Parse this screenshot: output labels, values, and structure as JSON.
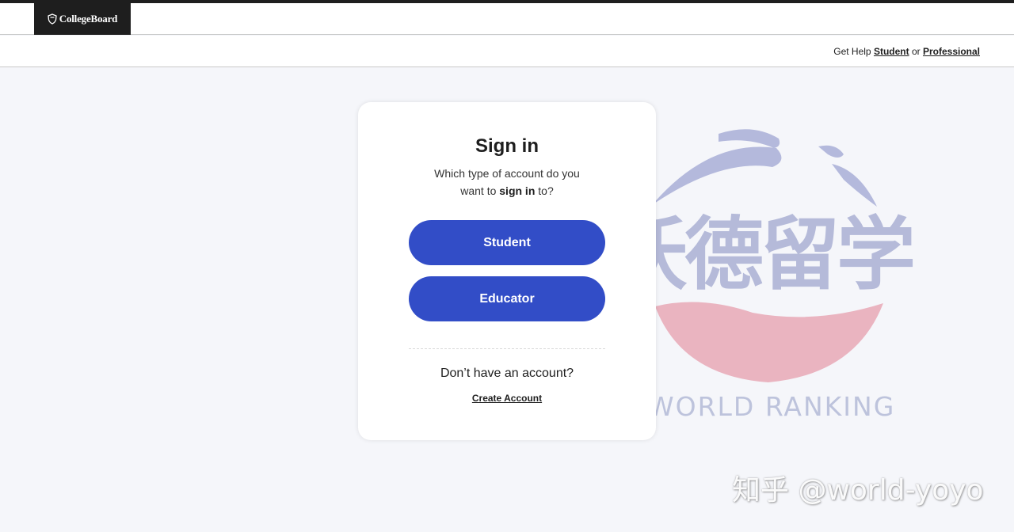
{
  "header": {
    "brand": "CollegeBoard",
    "logo_icon": "acorn-shield-icon"
  },
  "help_bar": {
    "prefix": "Get Help",
    "student_link": "Student",
    "separator": "or",
    "professional_link": "Professional"
  },
  "signin": {
    "title": "Sign in",
    "subtitle_line1": "Which type of account do you",
    "subtitle_pre": "want to",
    "subtitle_bold": "sign in",
    "subtitle_post": "to?",
    "student_button": "Student",
    "educator_button": "Educator",
    "no_account": "Don’t have an account?",
    "create_account": "Create Account"
  },
  "watermark": {
    "chinese_name": "沃德留学",
    "english_name": "WORLD RANKING",
    "attribution": "知乎 @world-yoyo"
  },
  "colors": {
    "brand_dark": "#1e1e1e",
    "button_blue": "#324dc7",
    "page_bg": "#f5f6fa",
    "watermark_blue": "#b4b9dc",
    "watermark_pink": "#eab4c0"
  }
}
